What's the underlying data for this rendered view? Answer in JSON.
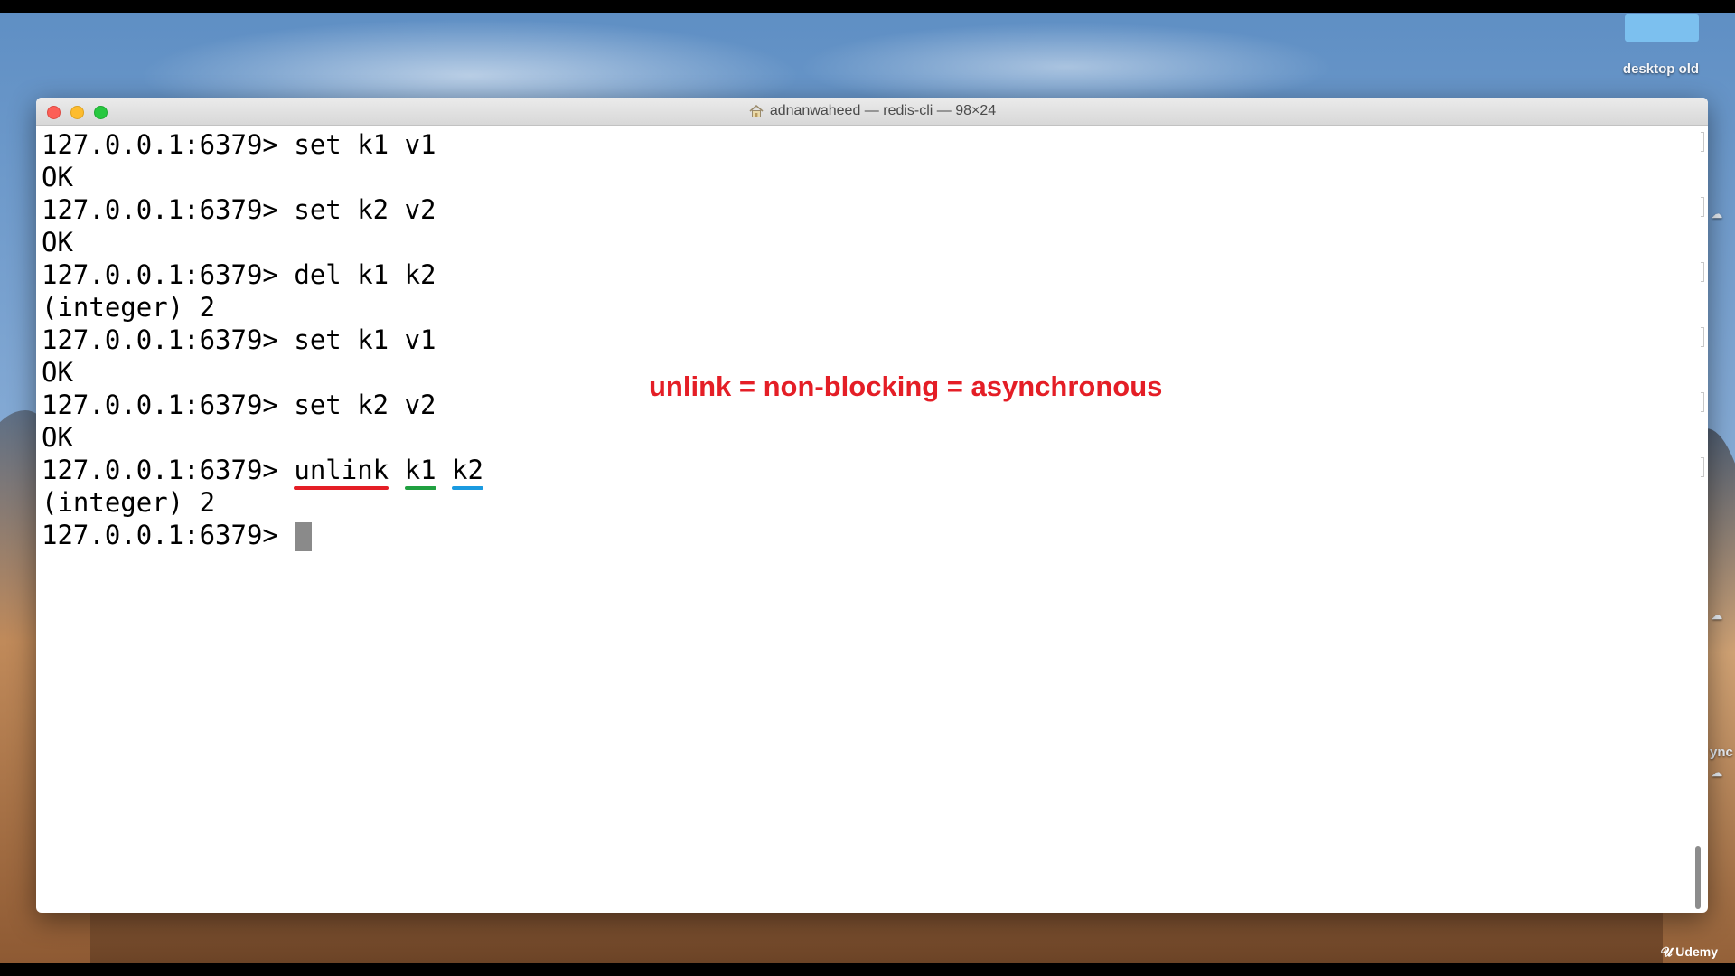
{
  "desktop": {
    "folder_label": "desktop old",
    "side_text": "ync",
    "watermark": "Udemy"
  },
  "window": {
    "title": "adnanwaheed — redis-cli — 98×24"
  },
  "terminal": {
    "prompt": "127.0.0.1:6379>",
    "lines": [
      {
        "type": "cmd",
        "text": "set k1 v1"
      },
      {
        "type": "out",
        "text": "OK"
      },
      {
        "type": "cmd",
        "text": "set k2 v2"
      },
      {
        "type": "out",
        "text": "OK"
      },
      {
        "type": "cmd",
        "text": "del k1 k2"
      },
      {
        "type": "out",
        "text": "(integer) 2"
      },
      {
        "type": "cmd",
        "text": "set k1 v1"
      },
      {
        "type": "out",
        "text": "OK"
      },
      {
        "type": "cmd",
        "text": "set k2 v2"
      },
      {
        "type": "out",
        "text": "OK"
      },
      {
        "type": "out",
        "text": "(integer) 2"
      }
    ],
    "unlink_command": {
      "cmd": "unlink",
      "arg1": "k1",
      "arg2": "k2"
    }
  },
  "annotation": {
    "text": "unlink = non-blocking = asynchronous",
    "color": "#e41e26"
  },
  "underline_colors": {
    "cmd": "#e41e26",
    "arg1": "#20a040",
    "arg2": "#1a9ae0"
  }
}
